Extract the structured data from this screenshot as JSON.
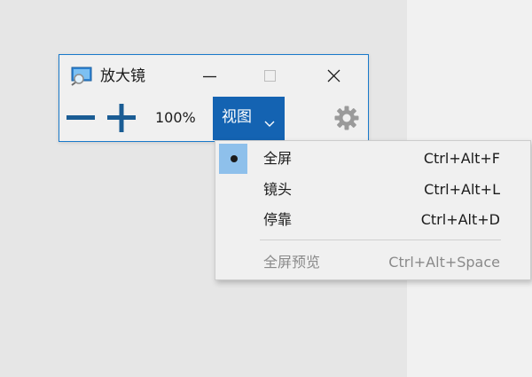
{
  "window": {
    "title": "放大镜",
    "border_color": "#1979ca",
    "buttons": [
      "minimize-icon",
      "maximize-icon",
      "close-icon"
    ]
  },
  "toolbar": {
    "zoom_out_icon": "minus-icon",
    "zoom_in_icon": "plus-icon",
    "zoom_level": "100%",
    "view_label": "视图",
    "view_icon": "chevron-down-icon",
    "settings_icon": "gear-icon",
    "accent_color": "#1463b2",
    "zoom_icon_color": "#1a5c94"
  },
  "view_menu": {
    "items": [
      {
        "label": "全屏",
        "shortcut": "Ctrl+Alt+F",
        "checked": true,
        "enabled": true
      },
      {
        "label": "镜头",
        "shortcut": "Ctrl+Alt+L",
        "checked": false,
        "enabled": true
      },
      {
        "label": "停靠",
        "shortcut": "Ctrl+Alt+D",
        "checked": false,
        "enabled": true
      },
      {
        "label": "全屏预览",
        "shortcut": "Ctrl+Alt+Space",
        "checked": false,
        "enabled": false
      }
    ],
    "check_highlight_color": "#8ec0eb",
    "disabled_text_color": "#8a8a8a"
  }
}
